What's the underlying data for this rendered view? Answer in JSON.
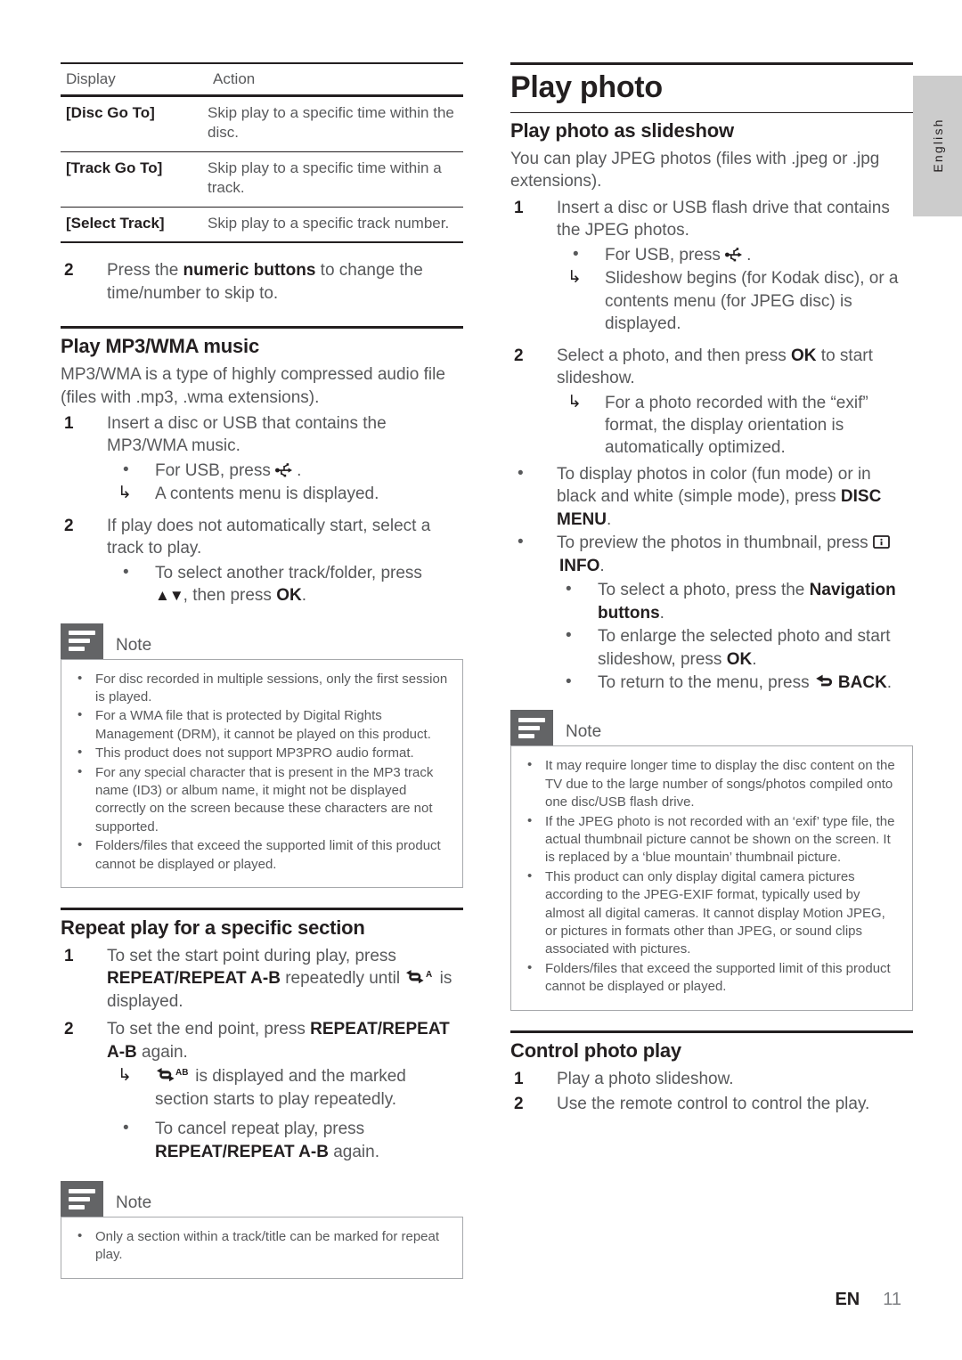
{
  "page": {
    "language_tab": "English",
    "footer_lang": "EN",
    "footer_page": "11"
  },
  "left_column": {
    "table": {
      "headers": [
        "Display",
        "Action"
      ],
      "rows": [
        {
          "display": "[Disc Go To]",
          "action": "Skip play to a specific time within the disc."
        },
        {
          "display": "[Track Go To]",
          "action": "Skip play to a specific time within a track."
        },
        {
          "display": "[Select Track]",
          "action": "Skip play to a specific track number."
        }
      ]
    },
    "step2": {
      "num": "2",
      "pre": "Press the ",
      "bold": "numeric buttons",
      "post": " to change the time/number to skip to."
    },
    "mp3": {
      "heading": "Play MP3/WMA music",
      "intro": "MP3/WMA is a type of highly compressed audio file (files with .mp3, .wma extensions).",
      "step1_num": "1",
      "step1": "Insert a disc or USB that contains the MP3/WMA music.",
      "step1_bullet_pre": "For USB, press ",
      "step1_bullet_post": ".",
      "step1_arrow": "A contents menu is displayed.",
      "step2_num": "2",
      "step2": "If play does not automatically start, select a track to play.",
      "step2_bullet_pre": "To select another track/folder, press ",
      "step2_bullet_mid": ", then press ",
      "step2_bullet_ok": "OK",
      "step2_bullet_post": "."
    },
    "note1": {
      "title": "Note",
      "items": [
        "For disc recorded in multiple sessions, only the first session is played.",
        "For a WMA file that is protected by Digital Rights Management (DRM), it cannot be played on this product.",
        "This product does not support MP3PRO audio format.",
        "For any special character that is present in the MP3 track name (ID3) or album name, it might not be displayed correctly on the screen because these characters are not supported.",
        "Folders/files that exceed the supported limit of this product cannot be displayed or played."
      ]
    },
    "repeat": {
      "heading": "Repeat play for a specific section",
      "step1_num": "1",
      "step1_a": "To set the start point during play, press ",
      "step1_kb": "REPEAT/REPEAT A-B",
      "step1_b": " repeatedly until ",
      "step1_c": " is displayed.",
      "step2_num": "2",
      "step2_a": "To set the end point, press ",
      "step2_kb": "REPEAT/REPEAT A-B",
      "step2_b": " again.",
      "arrow_a": " is displayed and the marked section starts to play repeatedly.",
      "bullet_a": "To cancel repeat play, press ",
      "bullet_kb": "REPEAT/REPEAT A-B",
      "bullet_b": " again."
    },
    "note2": {
      "title": "Note",
      "items": [
        "Only a section within a track/title can be marked for repeat play."
      ]
    }
  },
  "right_column": {
    "chapter_title": "Play photo",
    "slideshow": {
      "heading": "Play photo as slideshow",
      "intro": "You can play JPEG photos (files with .jpeg or .jpg extensions).",
      "step1_num": "1",
      "step1": "Insert a disc or USB flash drive that contains the JPEG photos.",
      "step1_bullet_pre": "For USB, press ",
      "step1_bullet_post": ".",
      "step1_arrow": "Slideshow begins (for Kodak disc), or a contents menu (for JPEG disc) is displayed.",
      "step2_num": "2",
      "step2_a": "Select a photo, and then press ",
      "step2_ok": "OK",
      "step2_b": " to start slideshow.",
      "step2_arrow": "For a photo recorded with the “exif” format, the display orientation is automatically optimized.",
      "bullet_disc_a": "To display photos in color (fun mode) or in black and white (simple mode), press ",
      "bullet_disc_kb": "DISC MENU",
      "bullet_disc_b": ".",
      "bullet_info_a": "To preview the photos in thumbnail, press ",
      "bullet_info_kb": "INFO",
      "bullet_info_b": ".",
      "bullet_nav_a": "To select a photo, press the ",
      "bullet_nav_kb": "Navigation buttons",
      "bullet_nav_b": ".",
      "bullet_enlarge_a": "To enlarge the selected photo and start slideshow, press ",
      "bullet_enlarge_ok": "OK",
      "bullet_enlarge_b": ".",
      "bullet_back_a": "To return to the menu, press ",
      "bullet_back_kb": "BACK",
      "bullet_back_b": "."
    },
    "note3": {
      "title": "Note",
      "items": [
        "It may require longer time to display the disc content on the TV due to the large number of songs/photos compiled onto one disc/USB flash drive.",
        "If the JPEG photo is not recorded with an ‘exif’ type file, the actual thumbnail picture cannot be shown on the screen. It is replaced by a ‘blue mountain’ thumbnail picture.",
        "This product can only display digital camera pictures according to the JPEG-EXIF format, typically used by almost all digital cameras. It cannot display Motion JPEG, or pictures in formats other than JPEG, or sound clips associated with pictures.",
        "Folders/files that exceed the supported limit of this product cannot be displayed or played."
      ]
    },
    "control": {
      "heading": "Control photo play",
      "step1_num": "1",
      "step1": "Play a photo slideshow.",
      "step2_num": "2",
      "step2": "Use the remote control to control the play."
    }
  },
  "icons": {
    "usb": "usb-icon",
    "arrow_step": "↳",
    "bullet": "•",
    "nav_up_down": "▲▼",
    "repeat_a": "repeat-a-icon",
    "repeat_ab": "repeat-ab-icon",
    "info": "info-icon",
    "back": "back-icon"
  }
}
